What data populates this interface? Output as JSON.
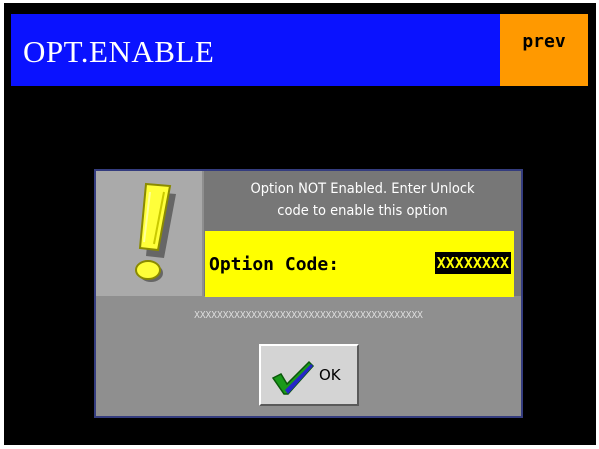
{
  "header": {
    "title": "OPT.ENABLE",
    "prev_label": "prev"
  },
  "dialog": {
    "message_line1": "Option NOT Enabled. Enter Unlock",
    "message_line2": "code to enable this option",
    "code_label": "Option Code:",
    "code_value": "XXXXXXXX",
    "mask": "XXXXXXXXXXXXXXXXXXXXXXXXXXXXXXXXXXXXXXXX",
    "ok_label": "OK"
  },
  "icons": {
    "warning": "exclamation-icon",
    "ok": "checkmark-icon"
  },
  "colors": {
    "header_bg": "#0a12ff",
    "prev_bg": "#ff9900",
    "code_bg": "#ffff00",
    "screen_bg": "#000000",
    "check_green": "#1a9a1a",
    "check_blue": "#2626c8"
  }
}
